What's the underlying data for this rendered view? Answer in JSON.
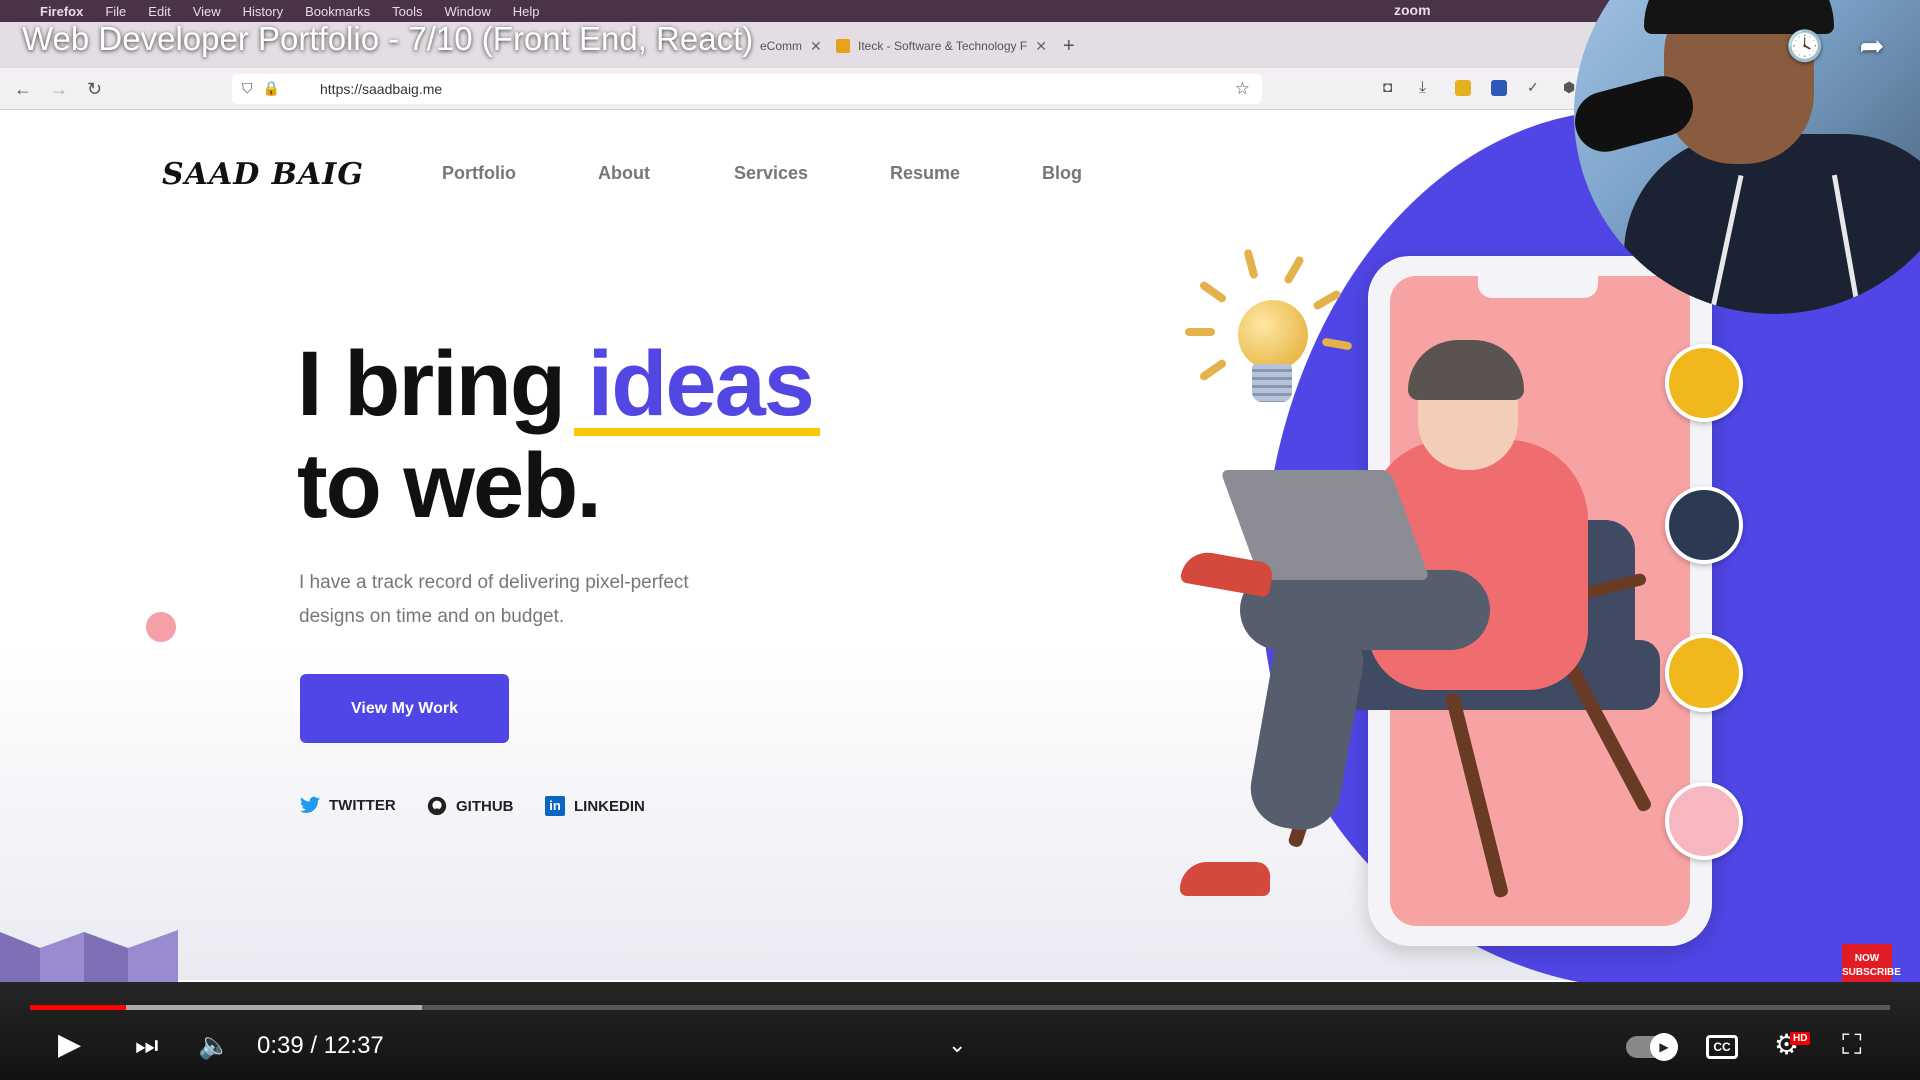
{
  "mac_menu": {
    "items": [
      "Firefox",
      "File",
      "Edit",
      "View",
      "History",
      "Bookmarks",
      "Tools",
      "Window",
      "Help"
    ],
    "zoom_label": "zoom"
  },
  "browser": {
    "tabs": [
      {
        "label": "eComm"
      },
      {
        "label": "Iteck - Software & Technology F"
      }
    ],
    "url": "https://saadbaig.me"
  },
  "site": {
    "logo": "SAAD BAIG",
    "nav": [
      "Portfolio",
      "About",
      "Services",
      "Resume",
      "Blog"
    ],
    "hero_plain": "I bring ",
    "hero_accent": "ideas",
    "hero_line2": "to web.",
    "description": "I have a track record of delivering pixel-perfect designs on time and on budget.",
    "cta": "View My Work",
    "social": [
      "TWITTER",
      "GITHUB",
      "LINKEDIN"
    ],
    "colors": {
      "accent": "#4f46e5",
      "underline": "#f7c900",
      "pink": "#f7a3a4"
    }
  },
  "video": {
    "title": "Web Developer Portfolio - 7/10 (Front End, React)",
    "current_time": "0:39",
    "duration": "12:37",
    "time_display": "0:39 / 12:37",
    "progress_played": 0.0516,
    "progress_buffered": 0.211,
    "subscribe_badge": "NOW SUBSCRIBE",
    "hd_badge": "HD"
  }
}
